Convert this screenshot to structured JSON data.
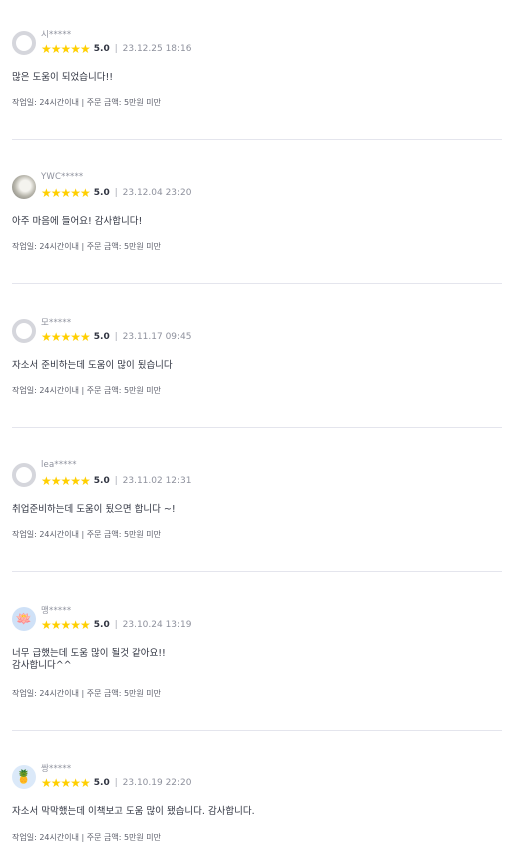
{
  "reviews": [
    {
      "nickname": "시*****",
      "avatar_icon": "default-avatar-icon",
      "stars": "★★★★★",
      "score": "5.0",
      "divider": "|",
      "date": "23.12.25 18:16",
      "content": "많은 도움이 되었습니다!!",
      "info": "작업일: 24시간이내 | 주문 금액: 5만원 미만"
    },
    {
      "nickname": "YWC*****",
      "avatar_icon": "photo-avatar-icon",
      "stars": "★★★★★",
      "score": "5.0",
      "divider": "|",
      "date": "23.12.04 23:20",
      "content": "아주 마음에 들어요! 감사합니다!",
      "info": "작업일: 24시간이내 | 주문 금액: 5만원 미만"
    },
    {
      "nickname": "모*****",
      "avatar_icon": "default-avatar-icon",
      "stars": "★★★★★",
      "score": "5.0",
      "divider": "|",
      "date": "23.11.17 09:45",
      "content": "자소서 준비하는데 도움이 많이 됬습니다",
      "info": "작업일: 24시간이내 | 주문 금액: 5만원 미만"
    },
    {
      "nickname": "lea*****",
      "avatar_icon": "default-avatar-icon",
      "stars": "★★★★★",
      "score": "5.0",
      "divider": "|",
      "date": "23.11.02 12:31",
      "content": "취업준비하는데 도움이 됬으면 합니다 ~!",
      "info": "작업일: 24시간이내 | 주문 금액: 5만원 미만"
    },
    {
      "nickname": "맹*****",
      "avatar_icon": "flower-avatar-icon",
      "stars": "★★★★★",
      "score": "5.0",
      "divider": "|",
      "date": "23.10.24 13:19",
      "content": "너무 급했는데 도움 많이 될것 같아요!!\n감사합니다^^",
      "info": "작업일: 24시간이내 | 주문 금액: 5만원 미만"
    },
    {
      "nickname": "쌍*****",
      "avatar_icon": "pineapple-avatar-icon",
      "stars": "★★★★★",
      "score": "5.0",
      "divider": "|",
      "date": "23.10.19 22:20",
      "content": "자소서 막막했는데 이책보고 도움 많이 됐습니다. 감사합니다.",
      "info": "작업일: 24시간이내 | 주문 금액: 5만원 미만"
    }
  ],
  "colors": {
    "star": "#ffcf00",
    "text": "#303441",
    "muted": "#8e919d",
    "separator": "#e4e5ed"
  }
}
